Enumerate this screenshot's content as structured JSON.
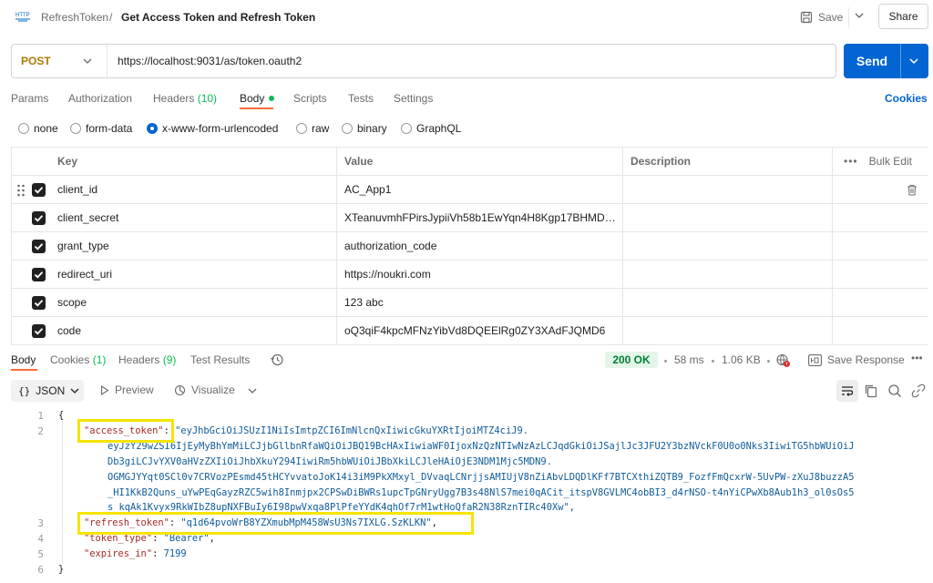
{
  "header": {
    "breadcrumb_parent": "RefreshToken",
    "breadcrumb_sep": "/",
    "title": "Get Access Token and Refresh Token",
    "save_label": "Save",
    "share_label": "Share",
    "http_icon_text": "HTTP"
  },
  "request": {
    "method": "POST",
    "url": "https://localhost:9031/as/token.oauth2",
    "send_label": "Send",
    "method_color": "#ad7a03",
    "send_color": "#0265d2"
  },
  "tabs": [
    {
      "label": "Params"
    },
    {
      "label": "Authorization"
    },
    {
      "label": "Headers",
      "count": "(10)"
    },
    {
      "label": "Body"
    },
    {
      "label": "Scripts"
    },
    {
      "label": "Tests"
    },
    {
      "label": "Settings"
    }
  ],
  "cookies_label": "Cookies",
  "body_types": [
    "none",
    "form-data",
    "x-www-form-urlencoded",
    "raw",
    "binary",
    "GraphQL"
  ],
  "body_type_selected": "x-www-form-urlencoded",
  "table": {
    "headers": {
      "key": "Key",
      "value": "Value",
      "description": "Description",
      "bulk_edit": "Bulk Edit"
    },
    "rows": [
      {
        "key": "client_id",
        "value": "AC_App1",
        "checked": true
      },
      {
        "key": "client_secret",
        "value": "XTeanuvmhFPirsJypiiVh58b1EwYqn4H8Kgp17BHMDRP…",
        "checked": true
      },
      {
        "key": "grant_type",
        "value": "authorization_code",
        "checked": true
      },
      {
        "key": "redirect_uri",
        "value": "https://noukri.com",
        "checked": true
      },
      {
        "key": "scope",
        "value": "123 abc",
        "checked": true
      },
      {
        "key": "code",
        "value": "oQ3qiF4kpcMFNzYibVd8DQEElRg0ZY3XAdFJQMD6",
        "checked": true
      }
    ]
  },
  "response": {
    "tabs": [
      {
        "label": "Body"
      },
      {
        "label": "Cookies",
        "count": "(1)"
      },
      {
        "label": "Headers",
        "count": "(9)"
      },
      {
        "label": "Test Results"
      }
    ],
    "status": "200 OK",
    "time": "58 ms",
    "size": "1.06 KB",
    "save_response": "Save Response",
    "format": "JSON",
    "preview": "Preview",
    "visualize": "Visualize",
    "code": {
      "line_numbers": [
        "1",
        "2",
        "3",
        "4",
        "5",
        "6"
      ],
      "open_brace": "{",
      "close_brace": "}",
      "access_token_key": "\"access_token\"",
      "access_token_lines": [
        "\"eyJhbGciOiJSUzI1NiIsImtpZCI6ImNlcnQxIiwicGkuYXRtIjoiMTZ4ciJ9.",
        "eyJzY29wZSI6IjEyMyBhYmMiLCJjbGllbnRfaWQiOiJBQ19BcHAxIiwiaWF0IjoxNzQzNTIwNzAzLCJqdGkiOiJSajlJc3JFU2Y3bzNVckF0U0o0Nks3IiwiTG5hbWUiOiJ",
        "Db3giLCJvYXV0aHVzZXIiOiJhbXkuY294IiwiRm5hbWUiOiJBbXkiLCJleHAiOjE3NDM1Mjc5MDN9.",
        "OGMGJYYqt0SCl0v7CRVozPEsmd45tHCYvvatoJoK14i3iM9PkXMxyl_DVvaqLCNrjjsAMIUjV8nZiAbvLDQDlKFf7BTCXthiZQTB9_FozfFmQcxrW-5UvPW-zXuJ8buzzA5",
        "_HI1KkB2Quns_uYwPEqGayzRZC5wih8Inmjpx2CPSwDiBWRs1upcTpGNryUgg7B3s48NlS7mei0qACit_itspV8GVLMC4obBI3_d4rNSO-t4nYiCPwXb8Aub1h3_ol0sOs5",
        "s_kqAk1Kvyx9RkWIbZ8upNXFBuIy6I98pwVxqa8PlPfeYYdK4qhOf7rM1wtHoQfaR2N38RznTIRc40Xw\","
      ],
      "refresh_token_key": "\"refresh_token\"",
      "refresh_token_value": "\"q1d64pvoWrB8YZXmubMpM458WsU3Ns7IXLG.SzKLKN\"",
      "token_type_key": "\"token_type\"",
      "token_type_value": "\"Bearer\"",
      "expires_in_key": "\"expires_in\"",
      "expires_in_value": "7199"
    }
  },
  "colors": {
    "accent_underline": "#ff6c37",
    "highlight": "#f7e400",
    "status_ok": "#007f31"
  }
}
